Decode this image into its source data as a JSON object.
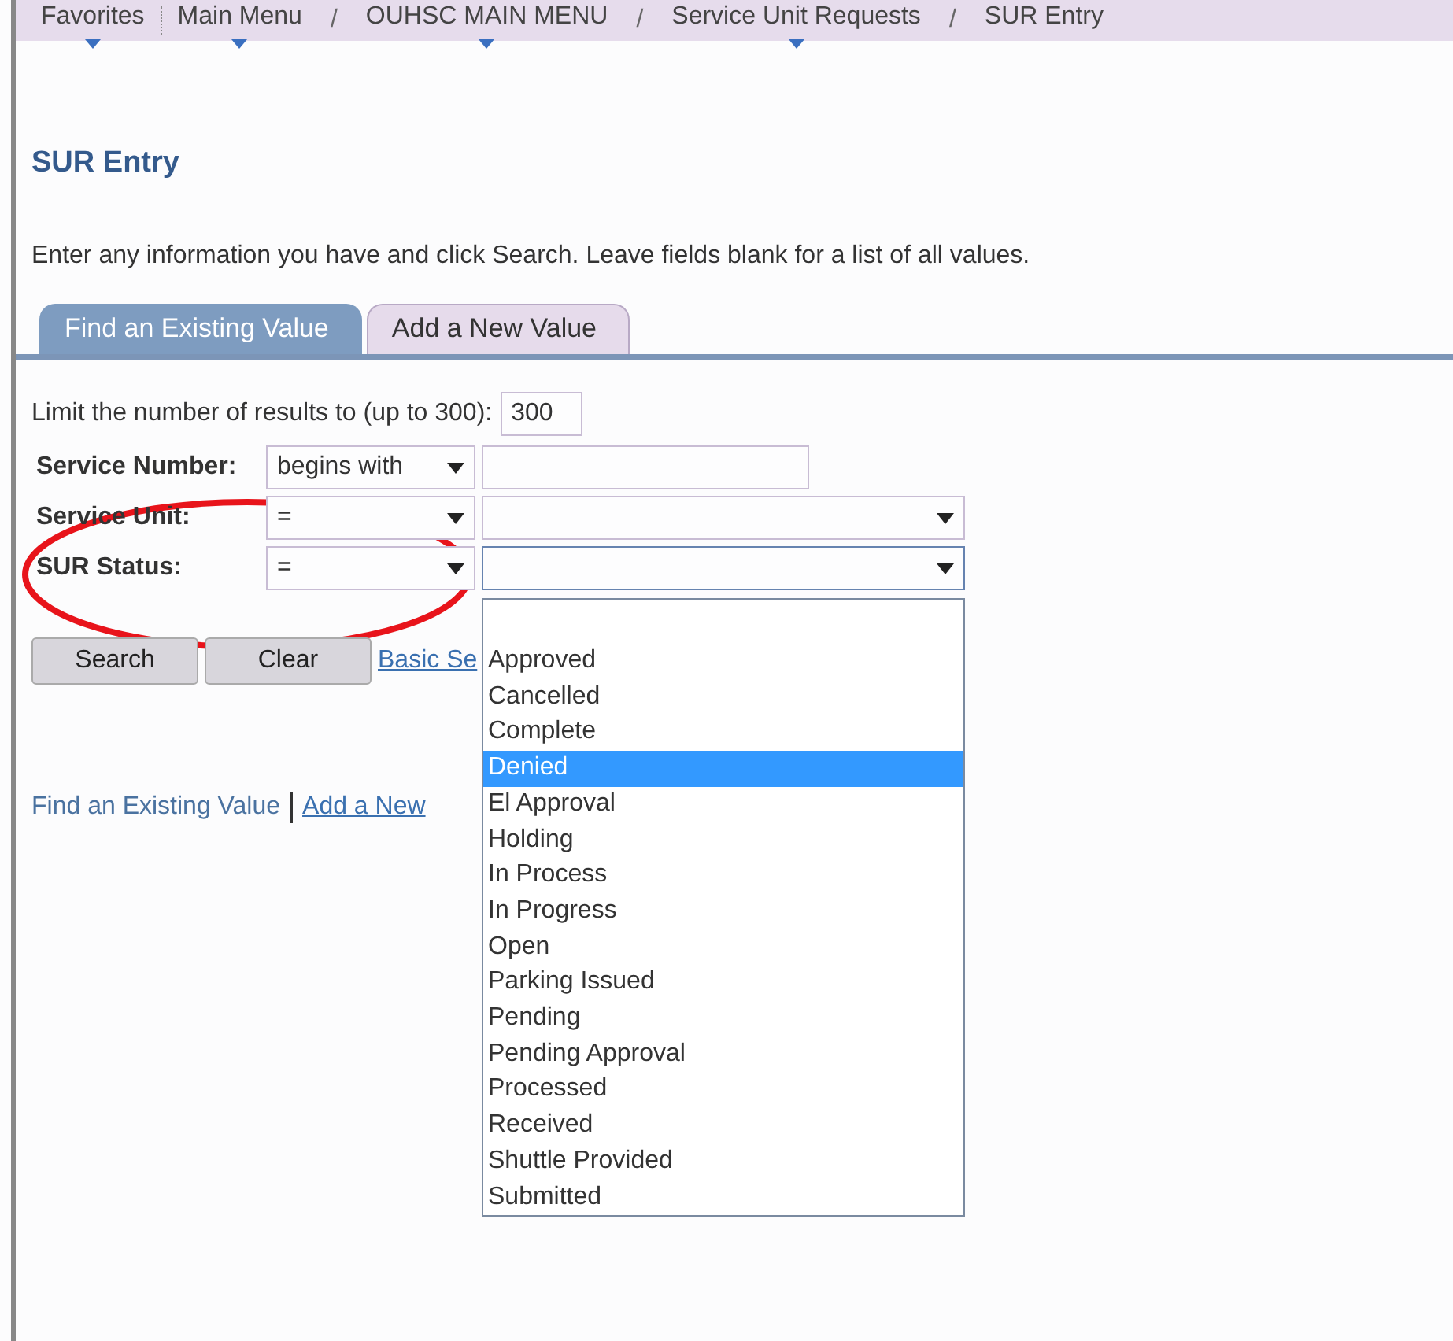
{
  "breadcrumb": [
    {
      "label": "Favorites",
      "menu": true
    },
    {
      "label": "Main Menu",
      "menu": true
    },
    {
      "label": "OUHSC MAIN MENU",
      "menu": true,
      "separator": "/"
    },
    {
      "label": "Service Unit Requests",
      "menu": true,
      "separator": "/"
    },
    {
      "label": "SUR Entry",
      "menu": false,
      "separator": "/"
    }
  ],
  "title": "SUR Entry",
  "instructions": "Enter any information you have and click Search. Leave fields blank for a list of all values.",
  "tabs": [
    {
      "label": "Find an Existing Value",
      "selected": true
    },
    {
      "label": "Add a New Value",
      "selected": false
    }
  ],
  "limit": {
    "label": "Limit the number of results to (up to 300):",
    "value": "300"
  },
  "criteria": [
    {
      "label": "Service Number:",
      "operator": "begins with",
      "kind": "text"
    },
    {
      "label": "Service Unit:",
      "operator": "=",
      "kind": "select"
    },
    {
      "label": "SUR Status:",
      "operator": "=",
      "kind": "select",
      "expanded": true
    }
  ],
  "buttons": [
    "Search",
    "Clear"
  ],
  "search_link": "Basic Se",
  "status_options": [
    {
      "label": "Approved",
      "selected": false
    },
    {
      "label": "Cancelled",
      "selected": false
    },
    {
      "label": "Complete",
      "selected": false
    },
    {
      "label": "Denied",
      "selected": true
    },
    {
      "label": "El Approval",
      "selected": false
    },
    {
      "label": "Holding",
      "selected": false
    },
    {
      "label": "In Process",
      "selected": false
    },
    {
      "label": "In Progress",
      "selected": false
    },
    {
      "label": "Open",
      "selected": false
    },
    {
      "label": "Parking Issued",
      "selected": false
    },
    {
      "label": "Pending",
      "selected": false
    },
    {
      "label": "Pending Approval",
      "selected": false
    },
    {
      "label": "Processed",
      "selected": false
    },
    {
      "label": "Received",
      "selected": false
    },
    {
      "label": "Shuttle Provided",
      "selected": false
    },
    {
      "label": "Submitted",
      "selected": false
    }
  ],
  "footer_links": [
    {
      "label": "Find an Existing Value",
      "link": false
    },
    {
      "label": "Add a New",
      "link": true
    }
  ],
  "highlight": {
    "kind": "ellipse"
  }
}
